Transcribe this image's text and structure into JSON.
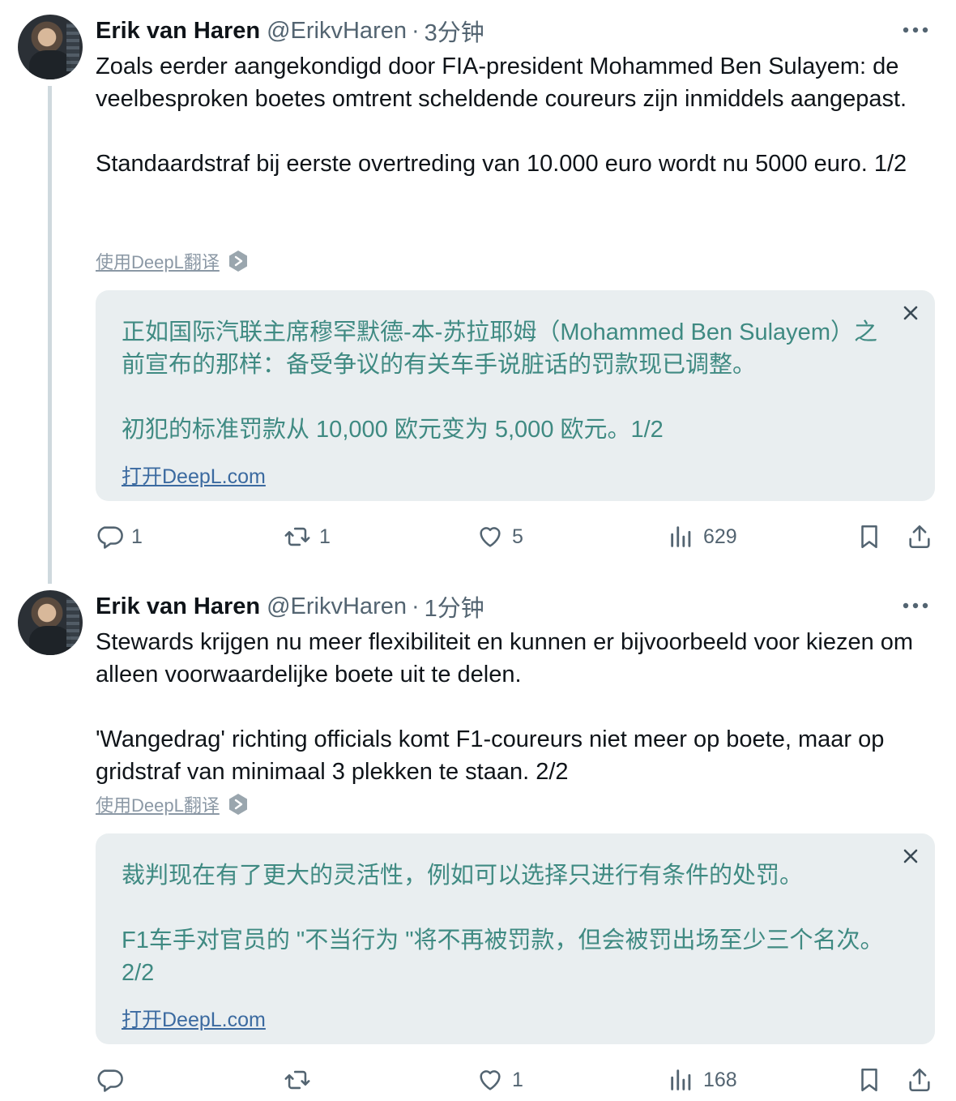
{
  "tweets": [
    {
      "author_name": "Erik van Haren",
      "handle": "@ErikvHaren",
      "separator": "·",
      "time": "3分钟",
      "body": "Zoals eerder aangekondigd door FIA-president Mohammed Ben Sulayem: de veelbesproken boetes omtrent scheldende coureurs zijn inmiddels aangepast.\n\nStandaardstraf bij eerste overtreding van 10.000 euro wordt nu 5000 euro. 1/2",
      "translate_label": "使用DeepL翻译",
      "translation": "正如国际汽联主席穆罕默德-本-苏拉耶姆（Mohammed Ben Sulayem）之前宣布的那样：备受争议的有关车手说脏话的罚款现已调整。\n\n初犯的标准罚款从 10,000 欧元变为 5,000 欧元。1/2",
      "open_link": "打开DeepL.com",
      "replies": "1",
      "retweets": "1",
      "likes": "5",
      "views": "629"
    },
    {
      "author_name": "Erik van Haren",
      "handle": "@ErikvHaren",
      "separator": "·",
      "time": "1分钟",
      "body": "Stewards krijgen nu meer flexibiliteit en kunnen er bijvoorbeeld voor kiezen om alleen voorwaardelijke boete uit te delen.\n\n'Wangedrag' richting officials komt F1-coureurs niet meer op boete, maar op gridstraf van minimaal 3 plekken te staan. 2/2",
      "translate_label": "使用DeepL翻译",
      "translation": "裁判现在有了更大的灵活性，例如可以选择只进行有条件的处罚。\n\nF1车手对官员的 \"不当行为 \"将不再被罚款，但会被罚出场至少三个名次。2/2",
      "open_link": "打开DeepL.com",
      "replies": "",
      "retweets": "",
      "likes": "1",
      "views": "168"
    }
  ],
  "icons": {
    "more": "more-icon",
    "deepl": "deepl-icon",
    "close": "close-icon",
    "reply": "reply-icon",
    "retweet": "retweet-icon",
    "like": "like-icon",
    "views": "views-icon",
    "bookmark": "bookmark-icon",
    "share": "share-icon"
  },
  "colors": {
    "translation_text": "#3f8a82",
    "link": "#3b6aa0",
    "card_bg": "#e9eef0",
    "secondary": "#536471"
  }
}
